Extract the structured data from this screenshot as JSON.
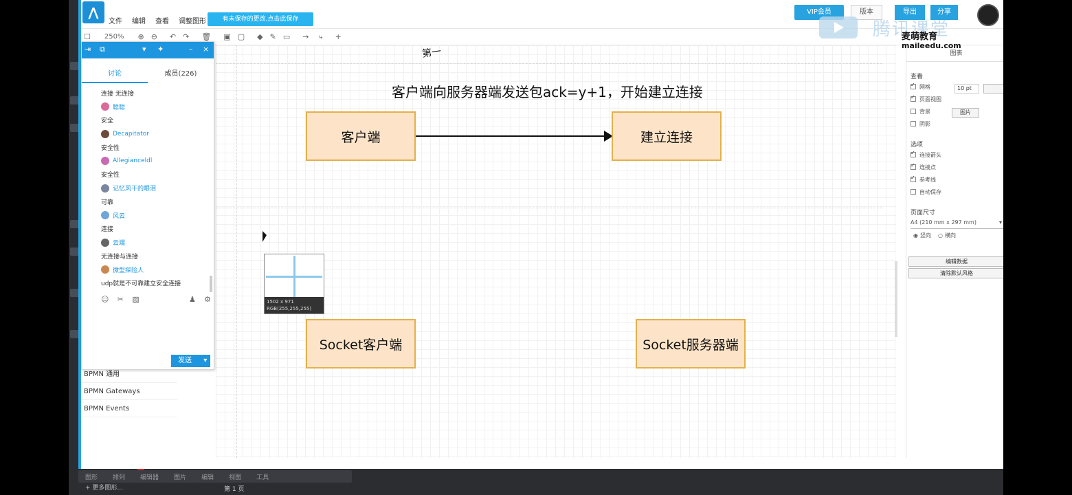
{
  "app": {
    "menu": [
      "文件",
      "编辑",
      "查看",
      "调整图形"
    ],
    "unsaved_notice": "有未保存的更改,点击此保存",
    "vip_label": "VIP会员",
    "btn_version": "版本",
    "btn_export": "导出",
    "btn_share": "分享",
    "zoom": "250%"
  },
  "diagram": {
    "heading": "客户端向服务器端发送包ack=y+1，开始建立连接",
    "scribble": "第一",
    "node_client": "客户端",
    "node_connect": "建立连接",
    "node_socket_client": "Socket客户端",
    "node_socket_server": "Socket服务器端",
    "tooltip_size": "1502 x 971",
    "tooltip_rgb": "RGB(255,255,255)"
  },
  "shape_list": [
    "BPMN 通用",
    "BPMN Gateways",
    "BPMN Events"
  ],
  "chat": {
    "tab_discuss": "讨论",
    "tab_members": "成员(226)",
    "first_line": "连接  无连接",
    "messages": [
      {
        "name": "聪聪",
        "text": "安全",
        "color": "#d96a9a"
      },
      {
        "name": "Decapitator",
        "text": "安全性",
        "color": "#6b4b3a"
      },
      {
        "name": "Allegianceldl",
        "text": "安全性",
        "color": "#c86bb0"
      },
      {
        "name": "记忆风干的眼泪",
        "text": "可靠",
        "color": "#7a86a0"
      },
      {
        "name": "风云",
        "text": "连接",
        "color": "#6fa6d8"
      },
      {
        "name": "云端",
        "text": "无连接与连接",
        "color": "#666666"
      },
      {
        "name": "微型探险人",
        "text": "udp就是不可靠建立安全连接",
        "color": "#c98850"
      }
    ],
    "send": "发送"
  },
  "right_panel": {
    "title": "图表",
    "section_view": "查看",
    "grid": "网格",
    "grid_size": "10 pt",
    "page_view": "页面视图",
    "background": "背景",
    "image_btn": "图片",
    "shadow": "阴影",
    "section_options": "选项",
    "connection_arrows": "连接箭头",
    "connection_points": "连接点",
    "guides": "参考线",
    "autosave": "自动保存",
    "section_paper": "页面尺寸",
    "paper_size": "A4 (210 mm x 297 mm)",
    "portrait": "竖向",
    "landscape": "横向",
    "btn_edit_data": "编辑数据",
    "btn_default_style": "清除默认风格"
  },
  "watermark": {
    "brand": "腾讯课堂",
    "school": "麦萌教育",
    "url": "maileedu.com"
  },
  "bottom": {
    "tabs": [
      "图形",
      "排列",
      "编辑器",
      "图片",
      "编辑",
      "视图",
      "工具"
    ],
    "page": "第 1 页",
    "add": "+  更多图形..."
  }
}
